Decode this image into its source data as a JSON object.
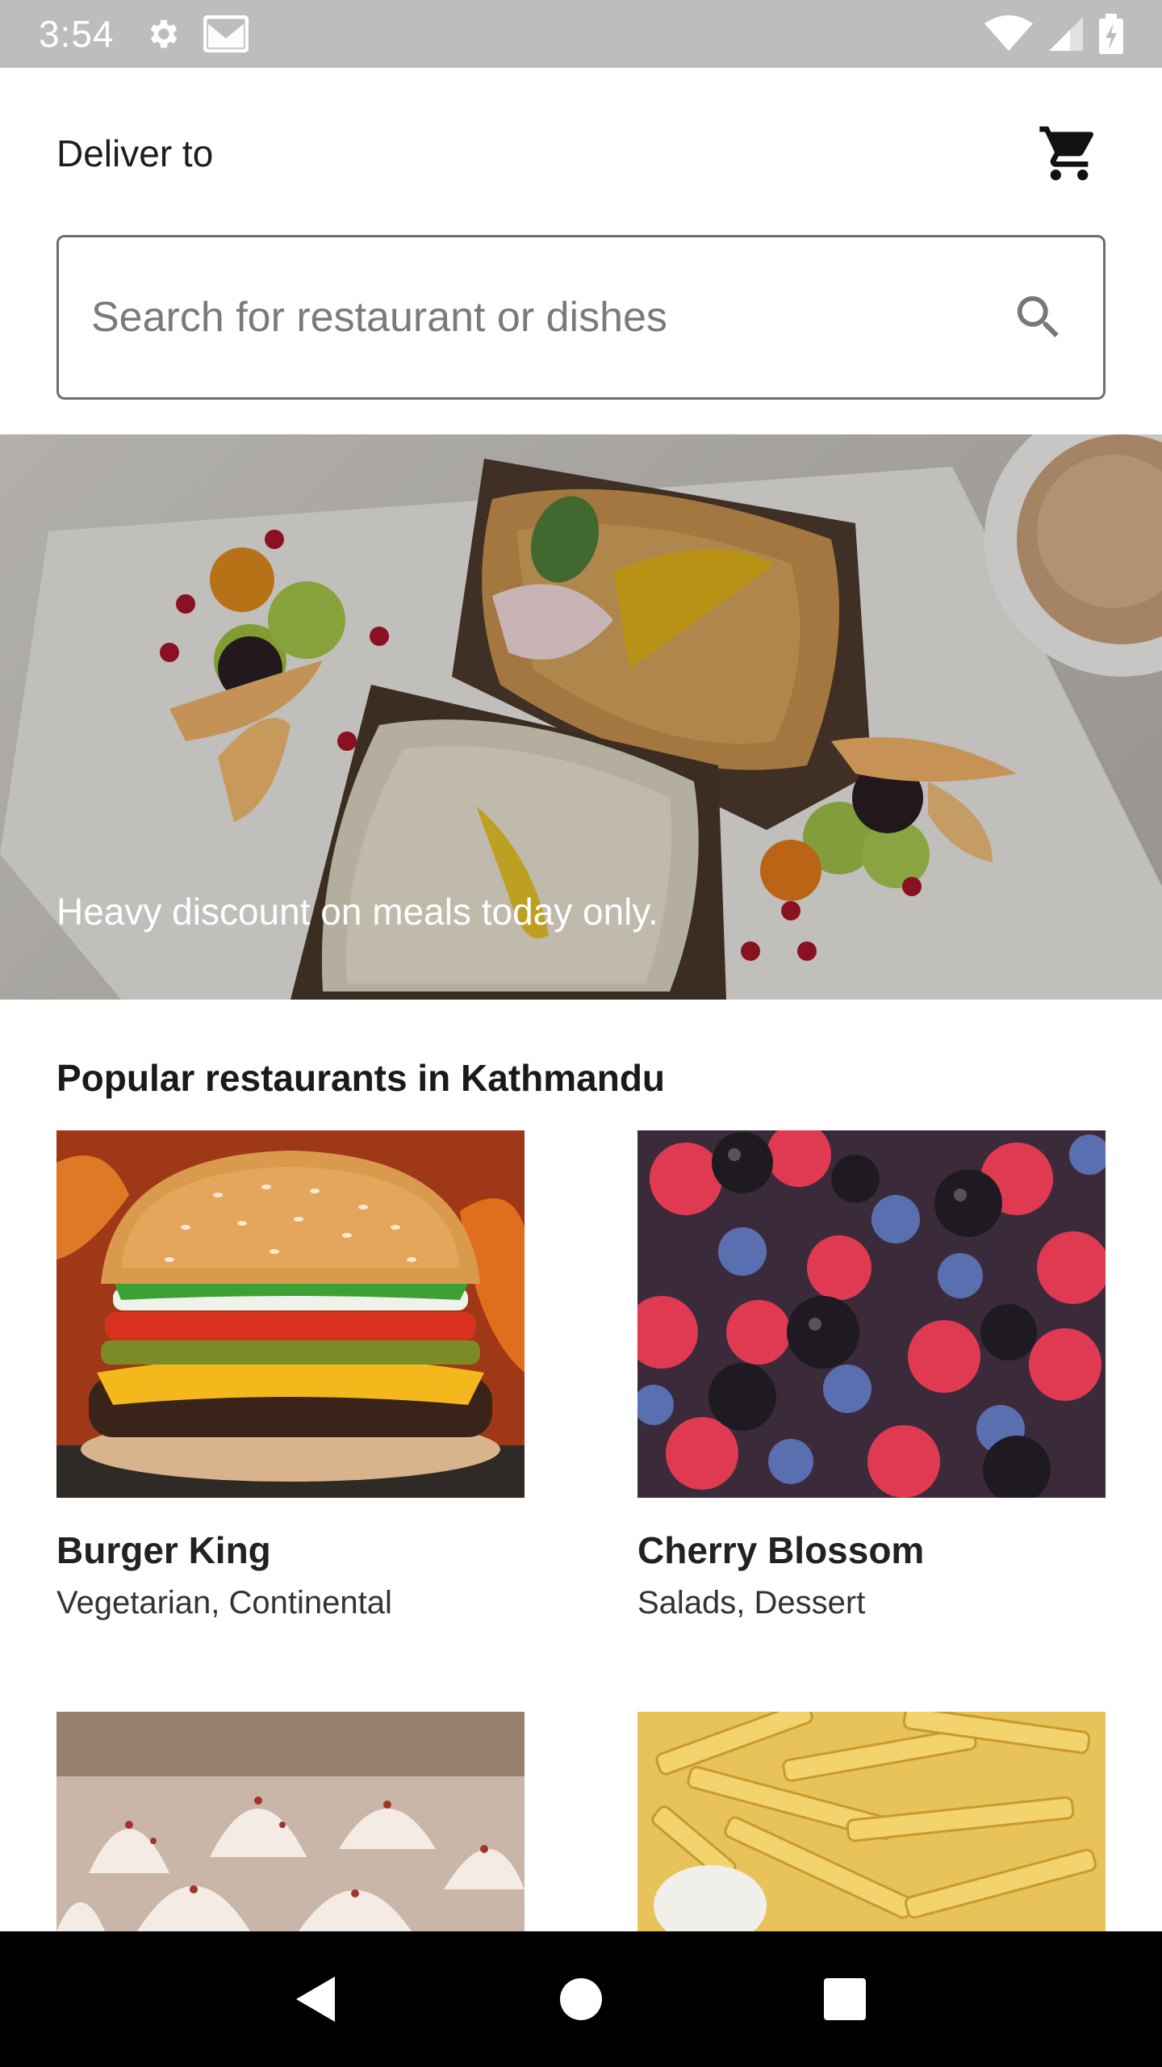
{
  "status_bar": {
    "time": "3:54",
    "icons": [
      "settings-icon",
      "gmail-icon",
      "wifi-icon",
      "signal-icon",
      "battery-charging-icon"
    ]
  },
  "header": {
    "deliver_label": "Deliver to",
    "cart_icon": "cart-icon"
  },
  "search": {
    "placeholder": "Search for restaurant or dishes",
    "icon": "search-icon"
  },
  "banner": {
    "caption": "Heavy discount on meals today only."
  },
  "popular": {
    "title": "Popular restaurants in Kathmandu",
    "restaurants": [
      {
        "name": "Burger King",
        "cuisine": "Vegetarian, Continental"
      },
      {
        "name": "Cherry Blossom",
        "cuisine": "Salads, Dessert"
      }
    ]
  },
  "nav_bar": {
    "icons": [
      "back-icon",
      "home-icon",
      "recents-icon"
    ]
  },
  "colors": {
    "status_bar": "#bdbdbd",
    "nav_bar": "#000000",
    "text_primary": "#1d1d1d",
    "border": "#6e6e6e"
  }
}
